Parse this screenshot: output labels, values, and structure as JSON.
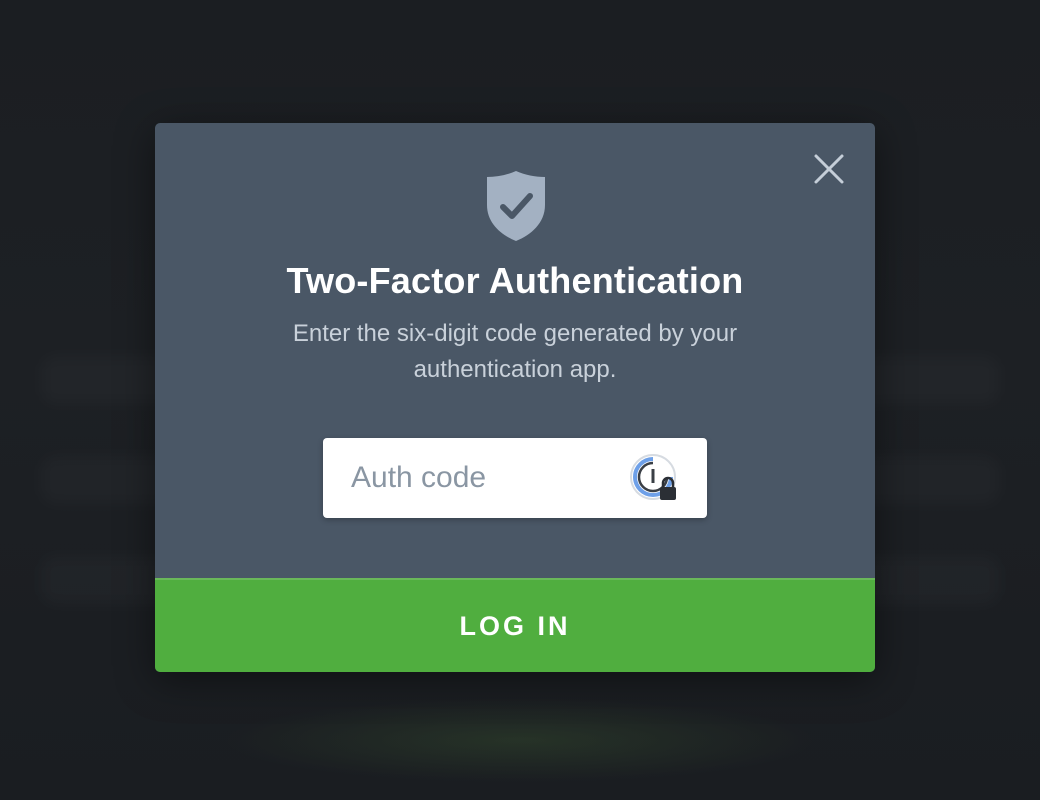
{
  "modal": {
    "title": "Two-Factor Authentication",
    "subtitle": "Enter the six-digit code generated by your authentication app.",
    "close_icon": "close-icon",
    "shield_icon": "shield-check-icon",
    "auth_input": {
      "value": "",
      "placeholder": "Auth code",
      "icon": "password-manager-icon"
    },
    "login_label": "LOG IN"
  },
  "colors": {
    "background": "#1a1d21",
    "modal_bg": "#4a5766",
    "shield": "#a3b1c2",
    "close": "#c5ced8",
    "button": "#50ae3f",
    "title_text": "#ffffff",
    "subtitle_text": "#c9d1da",
    "placeholder_text": "#8a96a3"
  }
}
